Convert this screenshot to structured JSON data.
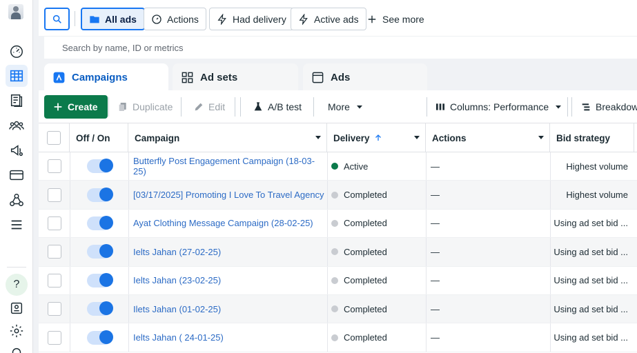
{
  "colors": {
    "accent": "#1877f2",
    "create_bg": "#0b7a4b",
    "link": "#2c6bc5",
    "active_dot": "#0b7a4b",
    "completed_dot": "#c9ccd1"
  },
  "rail": {
    "icons": [
      "avatar",
      "dashboard-icon",
      "campaigns-table-icon",
      "pages-icon",
      "audiences-icon",
      "ads-megaphone-icon",
      "billing-card-icon",
      "events-manager-icon",
      "menu-icon",
      "help-icon",
      "account-quality-icon",
      "settings-icon"
    ],
    "help": "?"
  },
  "filters": {
    "all_ads": "All ads",
    "actions": "Actions",
    "had_delivery": "Had delivery",
    "active_ads": "Active ads",
    "see_more": "See more"
  },
  "search": {
    "placeholder": "Search by name, ID or metrics"
  },
  "tabs": {
    "campaigns": "Campaigns",
    "ad_sets": "Ad sets",
    "ads": "Ads"
  },
  "toolbar": {
    "create": "Create",
    "duplicate": "Duplicate",
    "edit": "Edit",
    "ab_test": "A/B test",
    "more": "More",
    "columns": "Columns: Performance",
    "breakdown": "Breakdown"
  },
  "table": {
    "headers": {
      "off_on": "Off / On",
      "campaign": "Campaign",
      "delivery": "Delivery",
      "actions": "Actions",
      "bid_strategy": "Bid strategy"
    },
    "rows": [
      {
        "name": "Butterfly Post Engagement Campaign (18-03-25)",
        "delivery": "Active",
        "delivery_color": "#0b7a4b",
        "actions": "—",
        "bid": "Highest volume"
      },
      {
        "name": "[03/17/2025] Promoting I Love To Travel Agency",
        "delivery": "Completed",
        "delivery_color": "#c9ccd1",
        "actions": "—",
        "bid": "Highest volume"
      },
      {
        "name": "Ayat Clothing Message Campaign (28-02-25)",
        "delivery": "Completed",
        "delivery_color": "#c9ccd1",
        "actions": "—",
        "bid": "Using ad set bid ..."
      },
      {
        "name": "Ielts Jahan (27-02-25)",
        "delivery": "Completed",
        "delivery_color": "#c9ccd1",
        "actions": "—",
        "bid": "Using ad set bid ..."
      },
      {
        "name": "Ielts Jahan (23-02-25)",
        "delivery": "Completed",
        "delivery_color": "#c9ccd1",
        "actions": "—",
        "bid": "Using ad set bid ..."
      },
      {
        "name": "Ilets Jahan (01-02-25)",
        "delivery": "Completed",
        "delivery_color": "#c9ccd1",
        "actions": "—",
        "bid": "Using ad set bid ..."
      },
      {
        "name": "Ielts Jahan ( 24-01-25)",
        "delivery": "Completed",
        "delivery_color": "#c9ccd1",
        "actions": "—",
        "bid": "Using ad set bid ..."
      }
    ]
  }
}
